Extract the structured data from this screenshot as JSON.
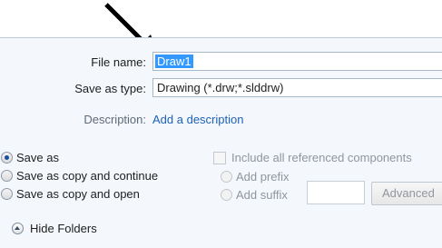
{
  "file_name": {
    "label": "File name:",
    "value": "Draw1"
  },
  "save_as_type": {
    "label": "Save as type:",
    "value": "Drawing (*.drw;*.slddrw)"
  },
  "description": {
    "label": "Description:",
    "link": "Add a description"
  },
  "save_options": [
    {
      "label": "Save as",
      "selected": true
    },
    {
      "label": "Save as copy and continue",
      "selected": false
    },
    {
      "label": "Save as copy and open",
      "selected": false
    }
  ],
  "include_refs_label": "Include all referenced components",
  "add_prefix_label": "Add prefix",
  "add_suffix_label": "Add suffix",
  "advanced_label": "Advanced",
  "hide_folders_label": "Hide Folders",
  "icons": {
    "pointer": "arrow-icon",
    "hide": "collapse-icon"
  }
}
